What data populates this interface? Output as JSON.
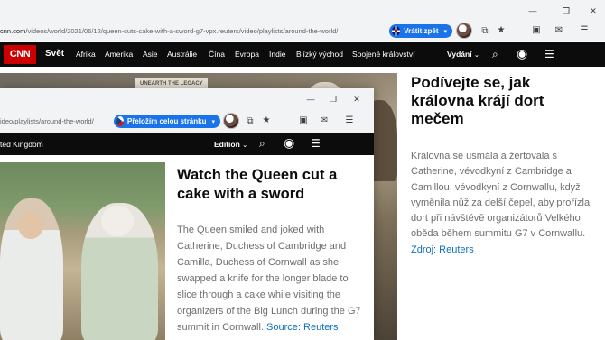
{
  "back_window": {
    "url_host": "cnn.com",
    "url_path": "/videos/world/2021/06/12/queen-cuts-cake-with-a-sword-g7-vpx.reuters/video/playlists/around-the-world/",
    "translate_label": "Vrátit zpět",
    "window_controls": {
      "minimize": "—",
      "restore": "❐",
      "close": "✕"
    },
    "nav": {
      "logo": "CNN",
      "section": "Svět",
      "items": [
        "Afrika",
        "Amerika",
        "Asie",
        "Austrálie",
        "Čína",
        "Evropa",
        "Indie",
        "Blízký východ",
        "Spojené království"
      ],
      "edition": "Vydání"
    },
    "photo_sign": "UNEARTH THE LEGACY",
    "article": {
      "title": "Podívejte se, jak královna krájí dort mečem",
      "body": "Královna se usmála a žertovala s Catherine, vévodkyní z Cambridge a Camillou, vévodkyní z Cornwallu, když vyměnila nůž za delší čepel, aby prořízla dort při návštěvě organizátorů Velkého oběda během summitu G7 v Cornwallu.",
      "source": "Zdroj: Reuters"
    }
  },
  "front_window": {
    "url_path": "ideo/playlists/around-the-world/",
    "translate_label": "Přeložím celou stránku",
    "window_controls": {
      "minimize": "—",
      "restore": "❐",
      "close": "✕"
    },
    "nav": {
      "section_partial": "ted Kingdom",
      "edition": "Edition"
    },
    "article": {
      "title": "Watch the Queen cut a cake with a sword",
      "body": "The Queen smiled and joked with Catherine, Duchess of Cambridge and Camilla, Duchess of Cornwall as she swapped a knife for the longer blade to slice through a cake while visiting the organizers of the Big Lunch during the G7 summit in",
      "body_tail": "Cornwall.",
      "source": "Source: Reuters"
    }
  },
  "colors": {
    "cnn_red": "#cc0000",
    "nav_bg": "#0c0c0c",
    "translate_blue": "#1a73e8",
    "link": "#0c6fbd"
  },
  "icons": [
    "uk-flag-icon",
    "cz-flag-icon",
    "dropdown-caret-icon",
    "extension-icon",
    "star-icon",
    "tab-search-icon",
    "mail-icon",
    "search-icon",
    "account-icon",
    "hamburger-menu-icon"
  ]
}
